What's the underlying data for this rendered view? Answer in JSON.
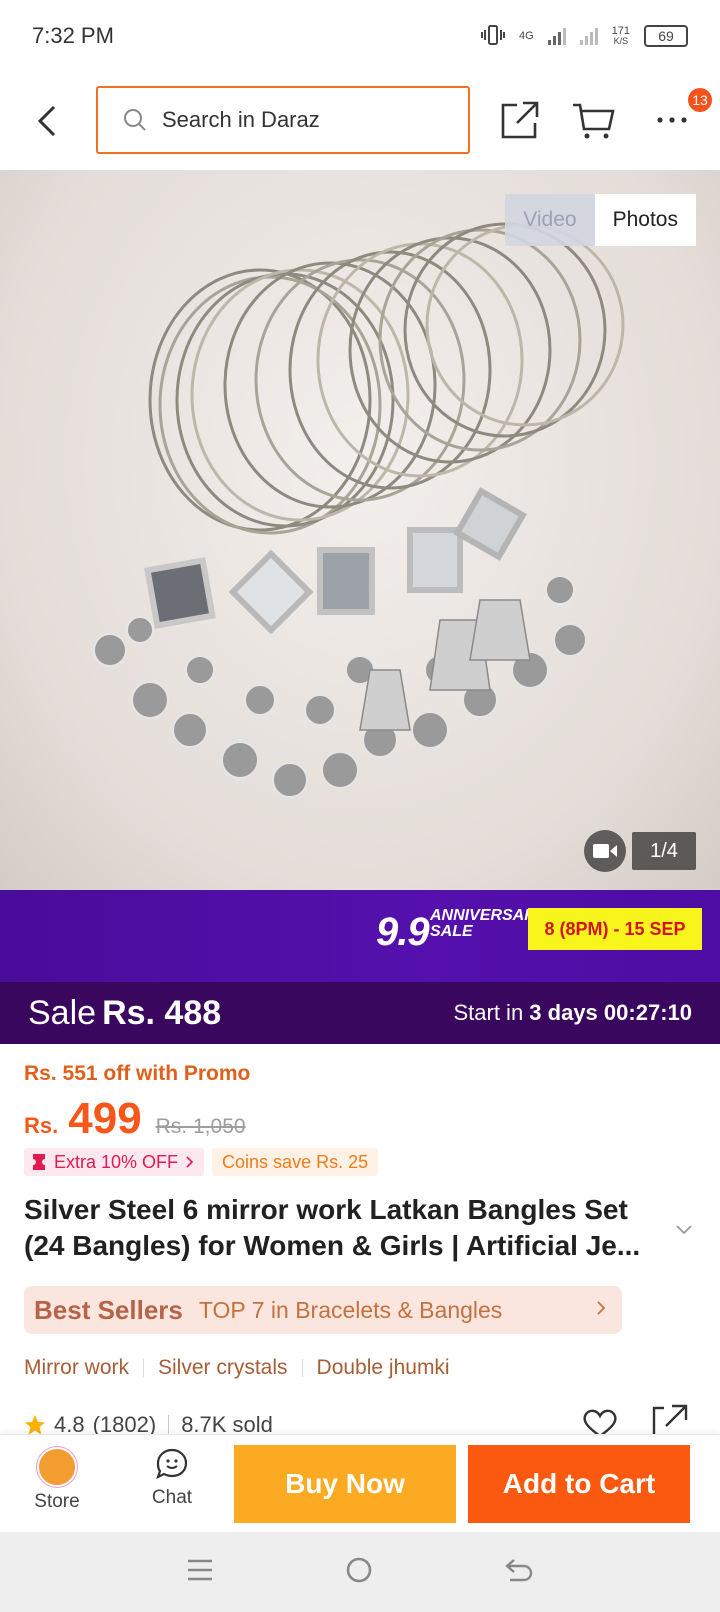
{
  "status_bar": {
    "time": "7:32 PM",
    "net_type": "4G",
    "speed_value": "171",
    "speed_unit": "K/S",
    "battery": "69"
  },
  "header": {
    "search_placeholder": "Search in Daraz",
    "cart_badge": "13"
  },
  "gallery": {
    "video_label": "Video",
    "photos_label": "Photos",
    "counter": "1/4",
    "image_desc": "silver bangles"
  },
  "campaign": {
    "big": "9.9",
    "small_line1": "ANNIVERSARY",
    "small_line2": "SALE",
    "dates": "8 (8PM) - 15 SEP"
  },
  "sale_bar": {
    "sale_label": "Sale",
    "sale_price": "Rs. 488",
    "start_prefix": "Start in ",
    "start_days": "3 days",
    "countdown": "00:27:10"
  },
  "product": {
    "promo": "Rs. 551 off with Promo",
    "currency": "Rs.",
    "price": "499",
    "original_price": "Rs. 1,050",
    "extra_off": "Extra 10% OFF",
    "coins": "Coins save Rs. 25",
    "title": "Silver Steel 6 mirror work Latkan Bangles Set (24 Bangles) for Women & Girls | Artificial Je...",
    "best_seller_label": "Best Sellers",
    "best_seller_text": "TOP 7 in Bracelets & Bangles",
    "features": [
      "Mirror work",
      "Silver crystals",
      "Double jhumki"
    ],
    "rating": "4.8",
    "rating_count": "(1802)",
    "sold": "8.7K sold"
  },
  "action_bar": {
    "store": "Store",
    "chat": "Chat",
    "buy_now": "Buy Now",
    "add_to_cart": "Add to Cart"
  },
  "colors": {
    "accent": "#f36f21",
    "campaign": "#5510ad",
    "buy": "#fcaa21",
    "cart": "#fa590f"
  }
}
